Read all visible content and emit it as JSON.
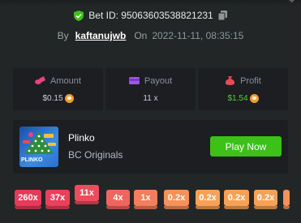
{
  "bet": {
    "label": "Bet ID: 95063603538821231",
    "by_label": "By",
    "username": "kaftanujwb",
    "on_label": "On",
    "datetime": "2022-11-11, 08:35:15"
  },
  "stats": [
    {
      "key": "amount",
      "label": "Amount",
      "value": "$0.15",
      "icon": "coins-icon",
      "coin_icon": "shib-coin-icon"
    },
    {
      "key": "payout",
      "label": "Payout",
      "value": "11 x",
      "icon": "card-icon"
    },
    {
      "key": "profit",
      "label": "Profit",
      "value": "$1.54",
      "icon": "moneybag-icon",
      "coin_icon": "shib-coin-icon",
      "value_color": "#52cc35"
    }
  ],
  "game": {
    "name": "Plinko",
    "provider": "BC Originals",
    "thumbnail_text": "PLINKO",
    "play_label": "Play Now"
  },
  "multipliers": [
    {
      "label": "260x",
      "color": "#e53a5a"
    },
    {
      "label": "37x",
      "color": "#e9405c"
    },
    {
      "label": "11x",
      "color": "#ee4b5f",
      "raised": true
    },
    {
      "label": "4x",
      "color": "#f2645e"
    },
    {
      "label": "1x",
      "color": "#f47d5c"
    },
    {
      "label": "0.2x",
      "color": "#f5915a"
    },
    {
      "label": "0.2x",
      "color": "#f7a157"
    },
    {
      "label": "0.2x",
      "color": "#f7a157"
    },
    {
      "label": "0.2x",
      "color": "#f7a157"
    },
    {
      "label": "",
      "color": "#f5915a"
    }
  ],
  "colors": {
    "background": "#232626",
    "panel": "#1c1e22",
    "accent_green": "#3bc117",
    "shield_green": "#3bc117",
    "amount_icon": "#e8437a",
    "payout_icon": "#9b57e8",
    "profit_icon": "#e84a54"
  }
}
